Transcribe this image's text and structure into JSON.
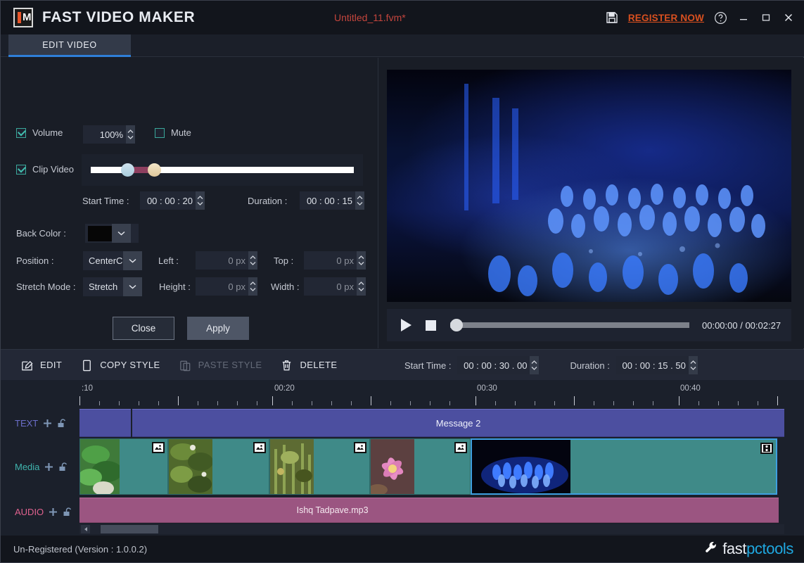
{
  "titlebar": {
    "app_name": "FAST VIDEO MAKER",
    "logo_letter": "M",
    "document_title": "Untitled_11.fvm*",
    "save_icon": "save-icon",
    "register_label": "REGISTER NOW",
    "help_icon": "help-icon",
    "minimize": "–",
    "maximize": "□",
    "close": "X",
    "accent_register": "#d9501f",
    "accent_doc": "#c4453d"
  },
  "tabs": [
    {
      "label": "EDIT VIDEO",
      "active": true
    }
  ],
  "properties": {
    "volume": {
      "checkbox_label": "Volume",
      "checked": true,
      "value": "100%",
      "mute_label": "Mute",
      "mute_checked": false
    },
    "clip_video": {
      "checkbox_label": "Clip Video",
      "checked": true,
      "start_time_label": "Start Time :",
      "start_time_value": "00 : 00 : 20",
      "duration_label": "Duration :",
      "duration_value": "00 : 00 : 15"
    },
    "back_color": {
      "label": "Back Color :",
      "value": "#000000"
    },
    "position": {
      "label": "Position :",
      "value": "CenterCe",
      "left_label": "Left :",
      "left_value": "0 px",
      "top_label": "Top :",
      "top_value": "0 px"
    },
    "stretch": {
      "label": "Stretch Mode :",
      "value": "Stretch",
      "height_label": "Height :",
      "height_value": "0 px",
      "width_label": "Width :",
      "width_value": "0 px"
    },
    "buttons": {
      "close": "Close",
      "apply": "Apply"
    }
  },
  "preview": {
    "play_icon": "play-icon",
    "stop_icon": "stop-icon",
    "current_time": "00:00:00",
    "separator": "/",
    "total_time": "00:02:27",
    "time_display": "00:00:00  /  00:02:27",
    "progress_percent": 0
  },
  "toolbar": {
    "items": [
      {
        "label": "EDIT",
        "icon": "edit-pencil-icon",
        "disabled": false
      },
      {
        "label": "COPY STYLE",
        "icon": "copy-icon",
        "disabled": false
      },
      {
        "label": "PASTE STYLE",
        "icon": "paste-icon",
        "disabled": true
      },
      {
        "label": "DELETE",
        "icon": "trash-icon",
        "disabled": false
      }
    ],
    "start_time_label": "Start Time :",
    "start_time_value": "00 : 00 : 30 . 00",
    "duration_label": "Duration :",
    "duration_value": "00 : 00 : 15 . 50"
  },
  "timeline": {
    "ruler_labels": [
      ":10",
      "00:20",
      "00:30",
      "00:40"
    ],
    "tracks": [
      {
        "name": "TEXT",
        "color": "#6b6ec9",
        "add_icon": "plus-icon",
        "lock_icon": "unlock-icon",
        "clips": [
          {
            "label": "",
            "start_pct": 0.0,
            "width_pct": 7.3
          },
          {
            "label": "Message 2",
            "start_pct": 7.5,
            "width_pct": 92.5
          }
        ]
      },
      {
        "name": "Media",
        "color": "#3fb3ad",
        "add_icon": "plus-icon",
        "lock_icon": "unlock-icon",
        "clips": [
          {
            "label": "",
            "start_pct": 0.0,
            "width_pct": 12.6,
            "badge": "image-icon"
          },
          {
            "label": "",
            "start_pct": 12.6,
            "width_pct": 14.3,
            "badge": "image-icon"
          },
          {
            "label": "",
            "start_pct": 26.9,
            "width_pct": 14.3,
            "badge": "image-icon"
          },
          {
            "label": "",
            "start_pct": 41.2,
            "width_pct": 14.3,
            "badge": "image-icon"
          },
          {
            "label": "",
            "start_pct": 55.5,
            "width_pct": 43.5,
            "badge": "film-icon",
            "selected": true
          }
        ]
      },
      {
        "name": "AUDIO",
        "color": "#e0628f",
        "add_icon": "plus-icon",
        "lock_icon": "unlock-icon",
        "clips": [
          {
            "label": "",
            "start_pct": 0.0,
            "width_pct": 29.8
          },
          {
            "label": "Ishq Tadpave.mp3",
            "start_pct": 29.8,
            "width_pct": 69.4
          }
        ]
      }
    ]
  },
  "statusbar": {
    "text": "Un-Registered (Version : 1.0.0.2)",
    "brand_icon": "wrench-icon",
    "brand_fast": "fast",
    "brand_pc": "pc",
    "brand_tools": "tools"
  }
}
